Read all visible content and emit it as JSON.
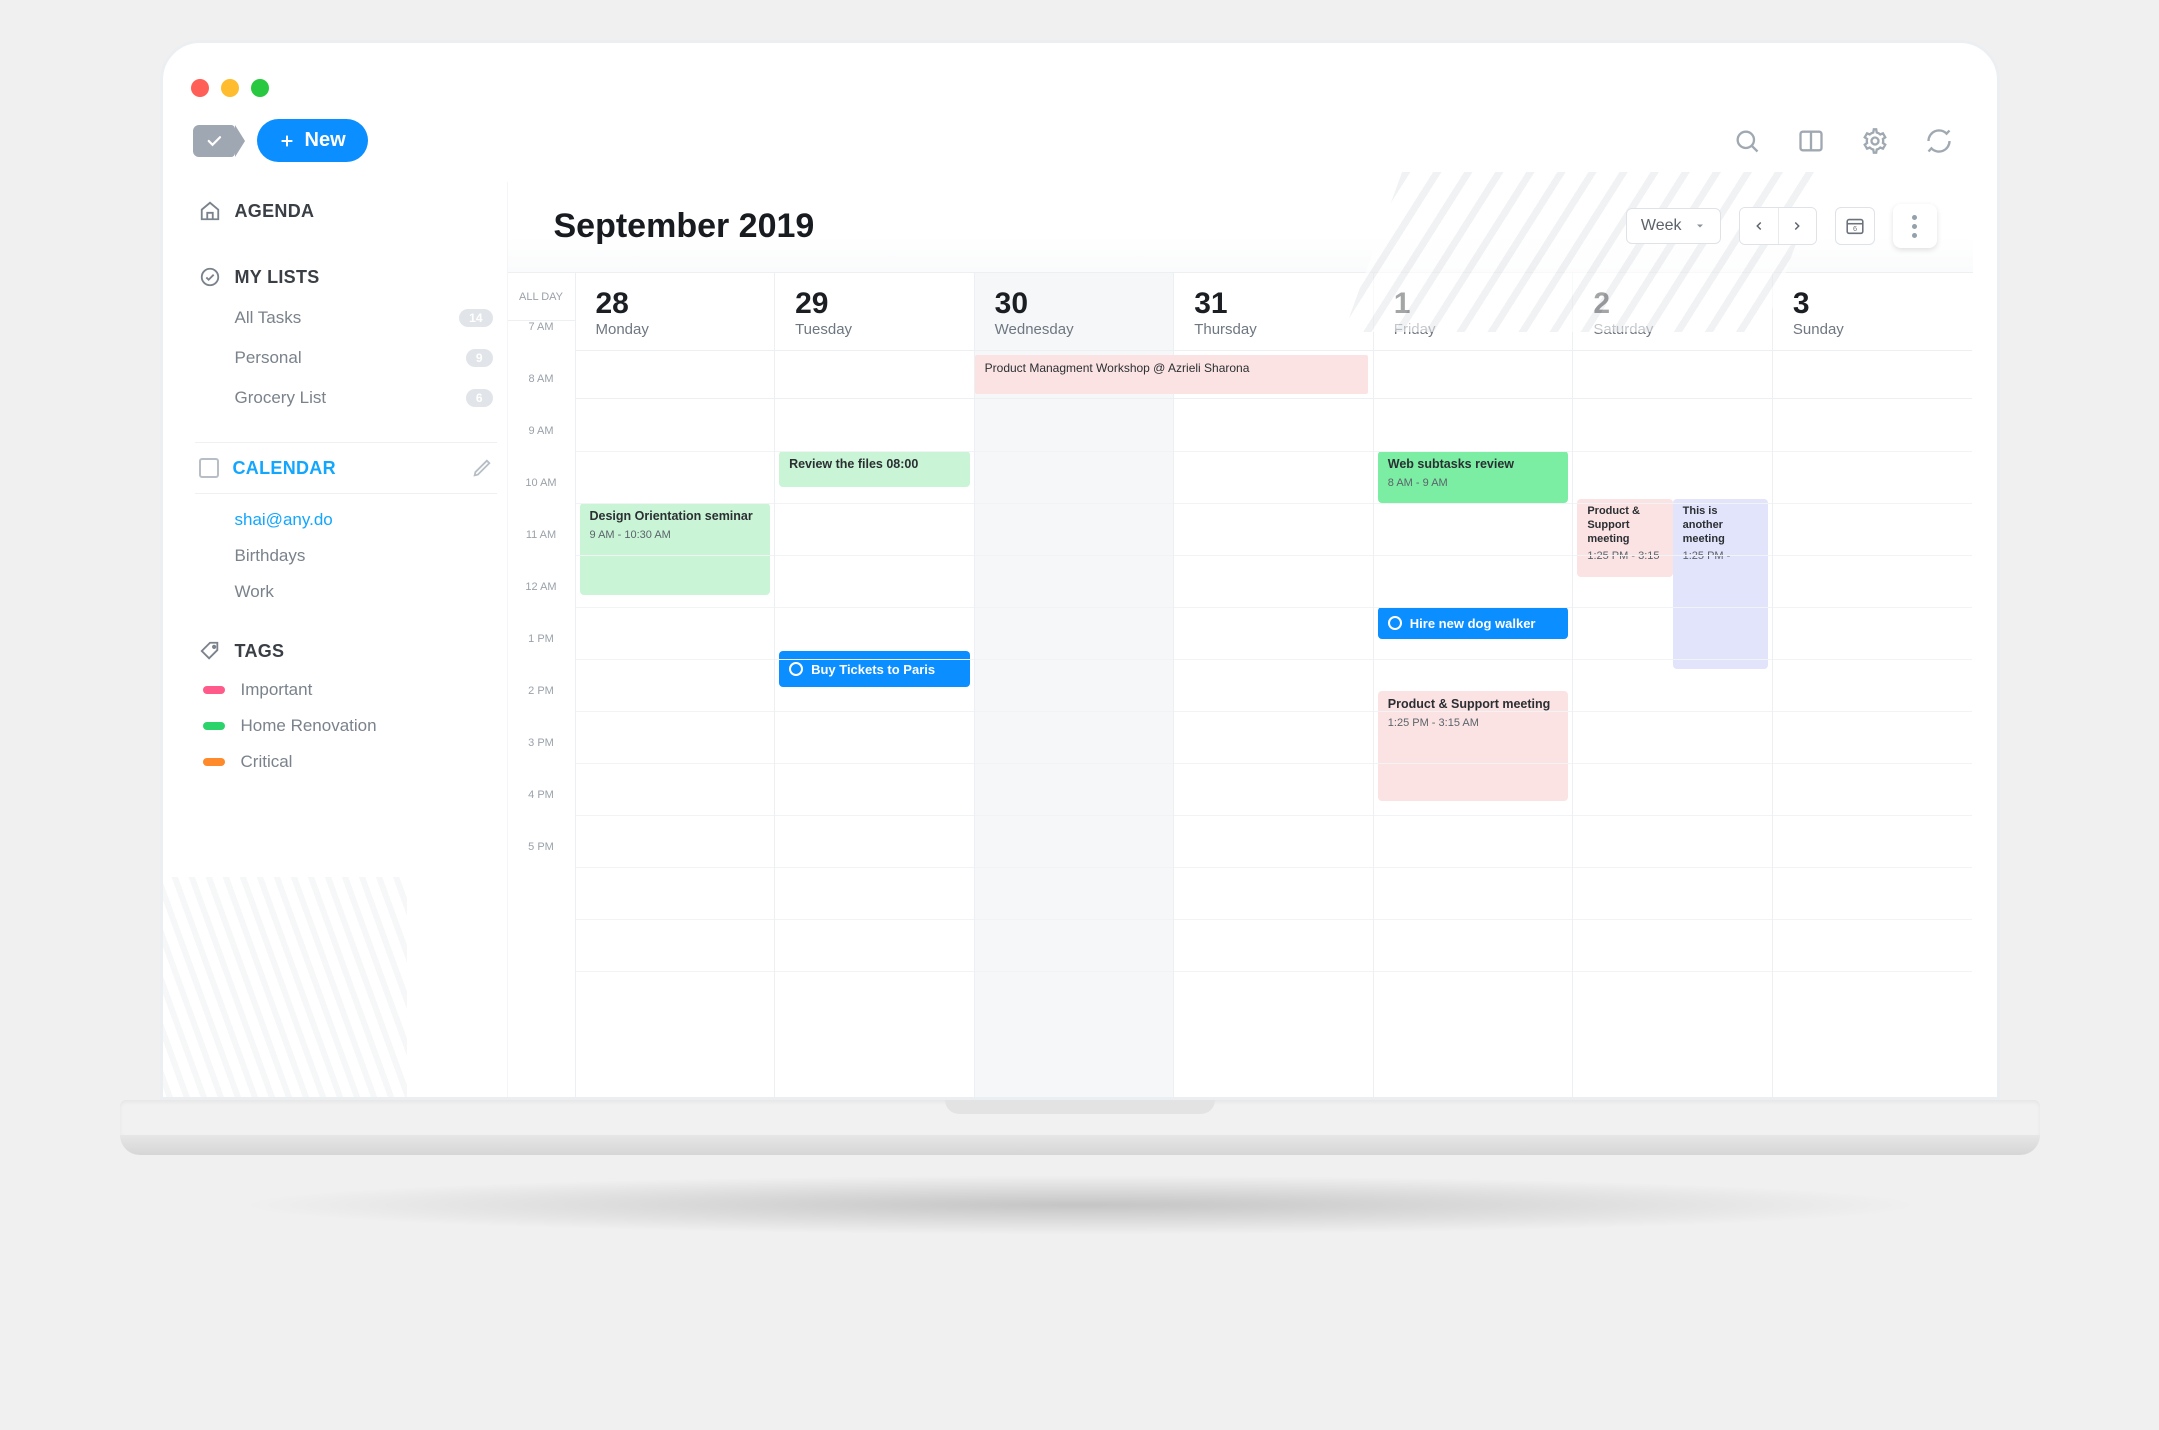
{
  "toolbar": {
    "new_label": "New"
  },
  "sidebar": {
    "agenda_label": "AGENDA",
    "mylists_label": "MY LISTS",
    "lists": [
      {
        "label": "All Tasks",
        "count": "14"
      },
      {
        "label": "Personal",
        "count": "9"
      },
      {
        "label": "Grocery List",
        "count": "6"
      }
    ],
    "calendar_label": "CALENDAR",
    "account": "shai@any.do",
    "calendars": [
      {
        "label": "Birthdays"
      },
      {
        "label": "Work"
      }
    ],
    "tags_label": "TAGS",
    "tags": [
      {
        "label": "Important",
        "color": "#ff5a8a"
      },
      {
        "label": "Home Renovation",
        "color": "#2bd46b"
      },
      {
        "label": "Critical",
        "color": "#ff8a2b"
      }
    ]
  },
  "header": {
    "title": "September 2019",
    "view_selector": "Week",
    "today_icon_day": "6"
  },
  "days": [
    {
      "num": "28",
      "dow": "Monday"
    },
    {
      "num": "29",
      "dow": "Tuesday"
    },
    {
      "num": "30",
      "dow": "Wednesday",
      "today": true
    },
    {
      "num": "31",
      "dow": "Thursday"
    },
    {
      "num": "1",
      "dow": "Friday"
    },
    {
      "num": "2",
      "dow": "Saturday"
    },
    {
      "num": "3",
      "dow": "Sunday"
    }
  ],
  "time_labels": {
    "allday": "ALL DAY",
    "slots": [
      "7 AM",
      "8 AM",
      "9 AM",
      "10 AM",
      "11 AM",
      "12 AM",
      "1 PM",
      "2 PM",
      "3 PM",
      "4 PM",
      "5 PM"
    ]
  },
  "allday_event": {
    "title": "Product Managment Workshop @ Azrieli Sharona"
  },
  "events": {
    "mon_design": {
      "title": "Design Orientation seminar",
      "sub": "9 AM - 10:30 AM"
    },
    "tue_review": {
      "title": "Review the files 08:00"
    },
    "tue_task": {
      "title": "Buy Tickets to Paris"
    },
    "fri_web": {
      "title": "Web subtasks review",
      "sub": "8 AM - 9 AM"
    },
    "fri_task": {
      "title": "Hire new dog walker"
    },
    "fri_meet": {
      "title": "Product & Support meeting",
      "sub": "1:25 PM - 3:15 AM"
    },
    "sat_meetA": {
      "title": "Product & Support meeting",
      "sub": "1:25 PM - 3:15"
    },
    "sat_meetB": {
      "title": "This is another meeting",
      "sub": "1:25 PM -"
    }
  },
  "colors": {
    "green_soft": "#c9f5d6",
    "green": "#7ceea4",
    "blue": "#0b8eff",
    "pink_soft": "#fbe3e3",
    "lilac": "#e2e4fb"
  }
}
